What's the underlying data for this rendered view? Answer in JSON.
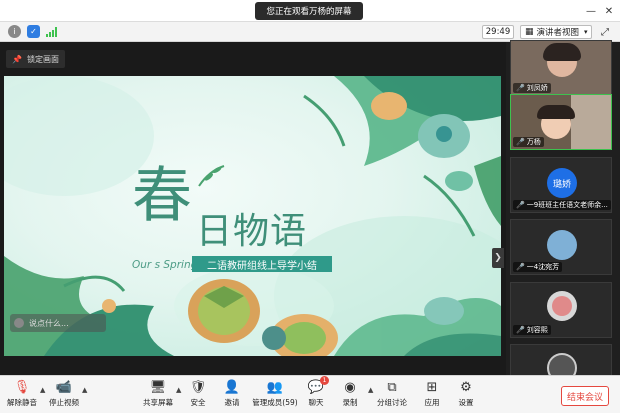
{
  "top_bar": {
    "viewing_label": "您正在观看万杨的屏幕",
    "minimize_icon": "minimize-icon",
    "close_icon": "close-icon"
  },
  "info_bar": {
    "timer": "29:49",
    "view_mode_label": "演讲者视图",
    "colors": {
      "info": "#888888",
      "shield": "#2f7de1",
      "signal": "#3ec24f"
    }
  },
  "share": {
    "lock_label": "锁定画面",
    "chat_placeholder": "说点什么..."
  },
  "slide": {
    "title_big": "春",
    "title_rest": "日物语",
    "english": "Our s Spring",
    "subtitle": "二语教研组线上导学小结",
    "colors": {
      "title": "#3f8f79",
      "banner": "#2f9a8a",
      "background": "#e3f5ef"
    }
  },
  "participants": [
    {
      "name": "刘凤娇"
    },
    {
      "name": "万杨"
    },
    {
      "name": "一9班班主任语文老师余...",
      "avatar_text": "璐娇"
    },
    {
      "name": "一4沈宛芳"
    },
    {
      "name": "刘容熙"
    }
  ],
  "toolbar": {
    "mute": "解除静音",
    "video": "停止视频",
    "share": "共享屏幕",
    "security": "安全",
    "invite": "邀请",
    "members": "管理成员(59)",
    "chat": "聊天",
    "chat_badge": "1",
    "record": "录制",
    "breakout": "分组讨论",
    "apps": "应用",
    "settings": "设置",
    "end": "结束会议"
  }
}
